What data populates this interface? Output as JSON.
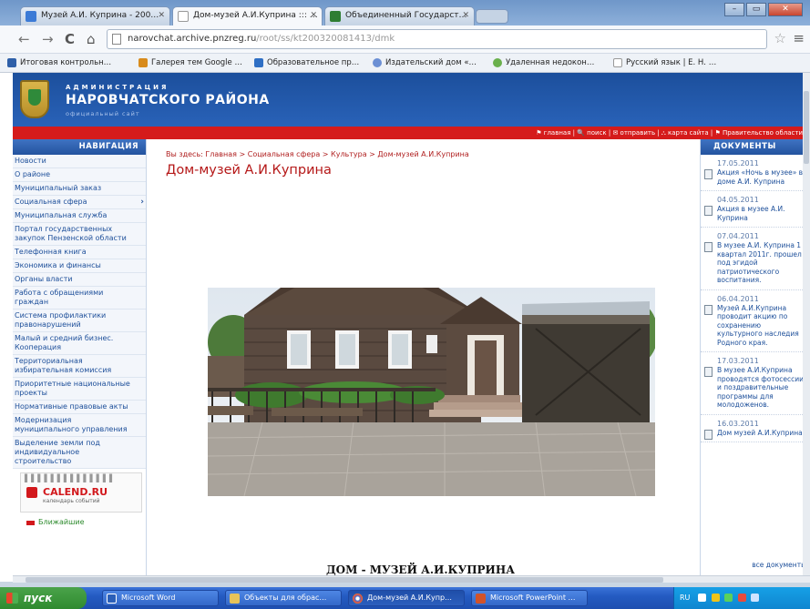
{
  "browser": {
    "tabs": [
      {
        "label": "Музей А.И. Куприна - 200…",
        "active": false
      },
      {
        "label": "Дом-музей А.И.Куприна ::: …",
        "active": true
      },
      {
        "label": "Объединенный Государст…",
        "active": false
      }
    ],
    "url_domain": "narovchat.archive.pnzreg.ru",
    "url_path": "/root/ss/kt200320081413/dmk",
    "bookmarks": [
      "Итоговая контрольн…",
      "Галерея тем Google …",
      "Образовательное пр…",
      "Издательский дом «…",
      "Удаленная недокон…",
      "Русский язык | Е. Н. …"
    ]
  },
  "site": {
    "header_small": "АДМИНИСТРАЦИЯ",
    "header_title": "НАРОВЧАТСКОГО РАЙОНА",
    "header_sub": "официальный сайт",
    "top_links": "⚑ главная | 🔍 поиск | ✉ отправить | ⛬ карта сайта | ⚑ Правительство области"
  },
  "nav": {
    "heading": "НАВИГАЦИЯ",
    "items": [
      {
        "label": "Новости",
        "arrow": false
      },
      {
        "label": "О районе",
        "arrow": false
      },
      {
        "label": "Муниципальный заказ",
        "arrow": false
      },
      {
        "label": "Социальная сфера",
        "arrow": true
      },
      {
        "label": "Муниципальная служба",
        "arrow": false
      },
      {
        "label": "Портал государственных закупок Пензенской области",
        "arrow": false
      },
      {
        "label": "Телефонная книга",
        "arrow": false
      },
      {
        "label": "Экономика и финансы",
        "arrow": false
      },
      {
        "label": "Органы власти",
        "arrow": false
      },
      {
        "label": "Работа с обращениями граждан",
        "arrow": false
      },
      {
        "label": "Система профилактики правонарушений",
        "arrow": false
      },
      {
        "label": "Малый и средний бизнес. Кооперация",
        "arrow": false
      },
      {
        "label": "Территориальная избирательная комиссия",
        "arrow": false
      },
      {
        "label": "Приоритетные национальные проекты",
        "arrow": false
      },
      {
        "label": "Нормативные правовые акты",
        "arrow": false
      },
      {
        "label": "Модернизация муниципального управления",
        "arrow": false
      },
      {
        "label": "Выделение земли под индивидуальное строительство",
        "arrow": false
      }
    ],
    "calend_logo": "CALEND.RU",
    "calend_sub": "календарь событий",
    "holidays": "Ближайшие"
  },
  "main": {
    "breadcrumb": "Вы здесь: Главная > Социальная сфера > Культура > Дом-музей А.И.Куприна",
    "title": "Дом-музей А.И.Куприна",
    "caption": "ДОМ - МУЗЕЙ А.И.КУПРИНА"
  },
  "docs": {
    "heading": "ДОКУМЕНТЫ",
    "items": [
      {
        "date": "17.05.2011",
        "text": "Акция «Ночь в музее» в доме А.И. Куприна"
      },
      {
        "date": "04.05.2011",
        "text": "Акция в музее А.И. Куприна"
      },
      {
        "date": "07.04.2011",
        "text": "В музее А.И. Куприна 1 квартал 2011г. прошел под эгидой патриотического воспитания."
      },
      {
        "date": "06.04.2011",
        "text": "Музей А.И.Куприна проводит акцию по сохранению культурного наследия Родного края."
      },
      {
        "date": "17.03.2011",
        "text": "В музее А.И.Куприна проводятся фотосессии и поздравительные программы для молодоженов."
      },
      {
        "date": "16.03.2011",
        "text": "Дом музей А.И.Куприна"
      }
    ],
    "all_link": "все документы"
  },
  "taskbar": {
    "start": "пуск",
    "tasks": [
      "Microsoft Word",
      "Объекты для обрас…",
      "Дом-музей А.И.Купр…",
      "Microsoft PowerPoint …"
    ],
    "tray_lang": "RU"
  }
}
